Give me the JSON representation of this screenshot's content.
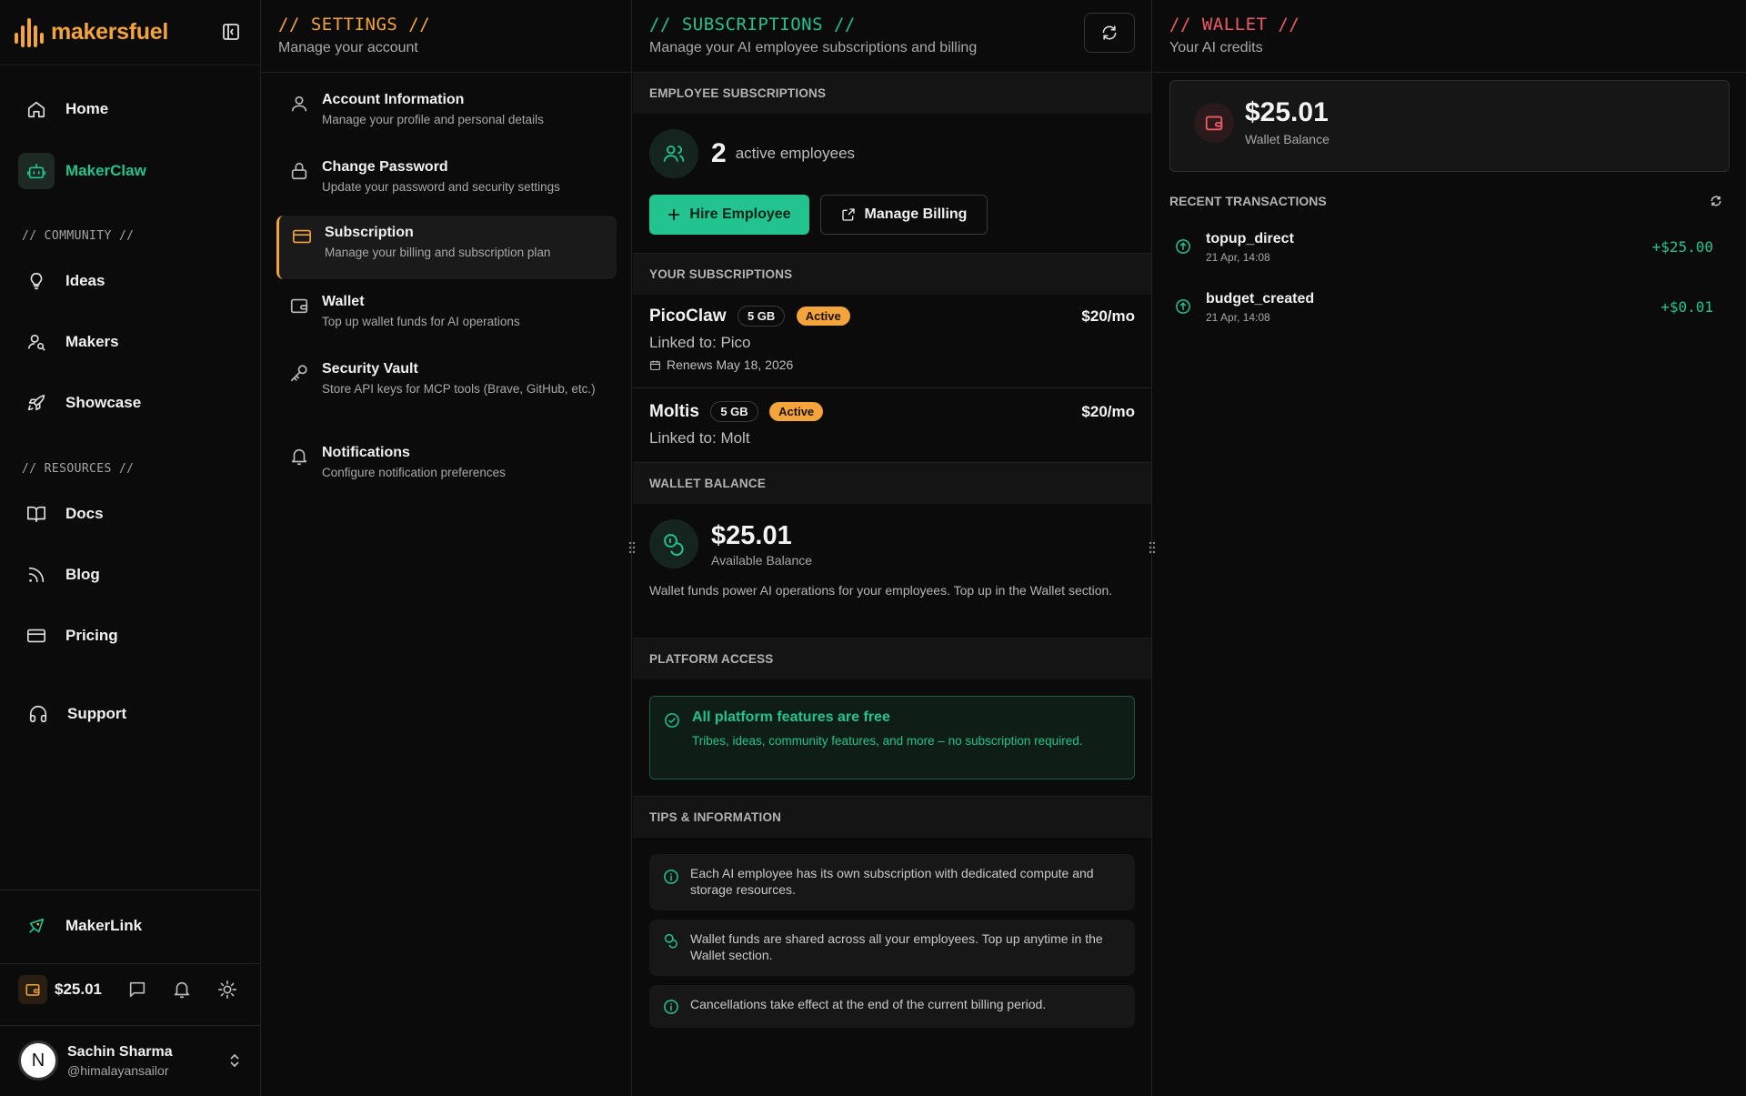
{
  "brand": {
    "name": "makersfuel",
    "accent": "#f3a43b",
    "green": "#22c38e"
  },
  "sidebar": {
    "items": [
      {
        "label": "Home",
        "icon": "home-icon"
      },
      {
        "label": "MakerClaw",
        "icon": "robot-icon",
        "active": true
      },
      {
        "label": "Ideas",
        "icon": "lightbulb-icon"
      },
      {
        "label": "Makers",
        "icon": "user-search-icon"
      },
      {
        "label": "Showcase",
        "icon": "rocket-icon"
      },
      {
        "label": "Docs",
        "icon": "book-icon"
      },
      {
        "label": "Blog",
        "icon": "rss-icon"
      },
      {
        "label": "Pricing",
        "icon": "credit-card-icon"
      },
      {
        "label": "Support",
        "icon": "headphones-icon"
      }
    ],
    "section_community": "// COMMUNITY //",
    "section_resources": "// RESOURCES //",
    "makerlink": "MakerLink",
    "balance": "$25.01",
    "user": {
      "initial": "N",
      "name": "Sachin Sharma",
      "handle": "@himalayansailor"
    }
  },
  "settings": {
    "title": "// SETTINGS //",
    "subtitle": "Manage your account",
    "menu": [
      {
        "title": "Account Information",
        "desc": "Manage your profile and personal details"
      },
      {
        "title": "Change Password",
        "desc": "Update your password and security settings"
      },
      {
        "title": "Subscription",
        "desc": "Manage your billing and subscription plan",
        "active": true
      },
      {
        "title": "Wallet",
        "desc": "Top up wallet funds for AI operations"
      },
      {
        "title": "Security Vault",
        "desc": "Store API keys for MCP tools (Brave, GitHub, etc.)"
      },
      {
        "title": "Notifications",
        "desc": "Configure notification preferences"
      }
    ]
  },
  "subscriptions": {
    "title": "// SUBSCRIPTIONS //",
    "subtitle": "Manage your AI employee subscriptions and billing",
    "employee_section": "EMPLOYEE SUBSCRIPTIONS",
    "active_count": "2",
    "active_label": "active employees",
    "hire_label": "Hire Employee",
    "billing_label": "Manage Billing",
    "your_section": "YOUR SUBSCRIPTIONS",
    "list": [
      {
        "name": "PicoClaw",
        "storage": "5 GB",
        "status": "Active",
        "price": "$20/mo",
        "linked": "Linked to: Pico",
        "renews": "Renews May 18, 2026"
      },
      {
        "name": "Moltis",
        "storage": "5 GB",
        "status": "Active",
        "price": "$20/mo",
        "linked": "Linked to: Molt"
      }
    ],
    "wallet_section": "WALLET BALANCE",
    "wallet_amount": "$25.01",
    "wallet_label": "Available Balance",
    "wallet_desc": "Wallet funds power AI operations for your employees. Top up in the Wallet section.",
    "platform_section": "PLATFORM ACCESS",
    "free_title": "All platform features are free",
    "free_desc": "Tribes, ideas, community features, and more – no subscription required.",
    "tips_section": "TIPS & INFORMATION",
    "tips": [
      "Each AI employee has its own subscription with dedicated compute and storage resources.",
      "Wallet funds are shared across all your employees. Top up anytime in the Wallet section.",
      "Cancellations take effect at the end of the current billing period."
    ]
  },
  "wallet": {
    "title": "// WALLET //",
    "subtitle": "Your AI credits",
    "balance": "$25.01",
    "balance_label": "Wallet Balance",
    "recent_label": "RECENT TRANSACTIONS",
    "transactions": [
      {
        "name": "topup_direct",
        "date": "21 Apr, 14:08",
        "amount": "+$25.00"
      },
      {
        "name": "budget_created",
        "date": "21 Apr, 14:08",
        "amount": "+$0.01"
      }
    ]
  }
}
